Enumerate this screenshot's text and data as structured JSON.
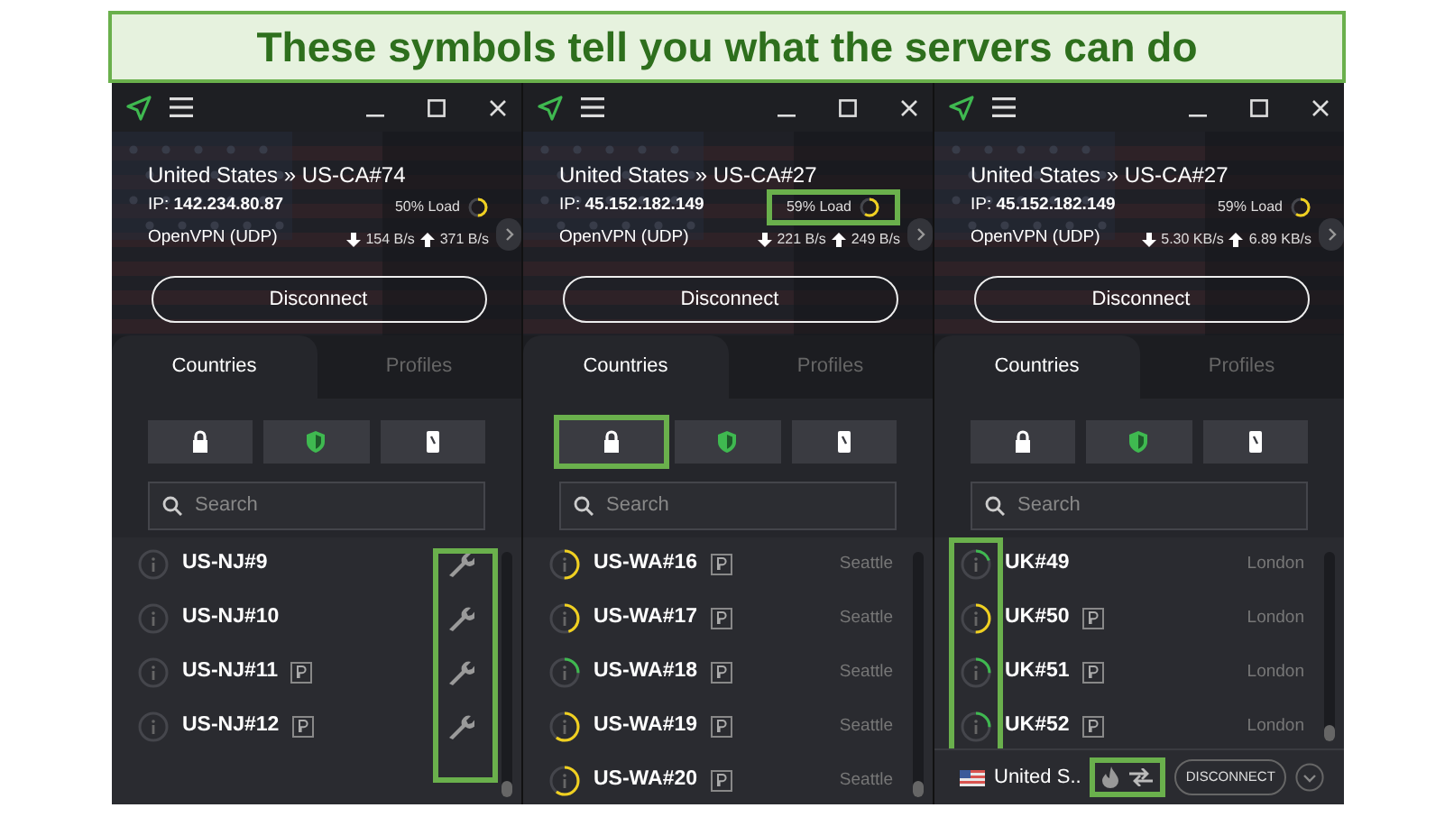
{
  "banner": {
    "text": "These symbols tell you what the servers can do"
  },
  "panels": [
    {
      "connection": {
        "location": "United States » US-CA#74",
        "ip_label": "IP:",
        "ip": "142.234.80.87",
        "load": "50% Load",
        "level": 0.5,
        "load_highlighted": false,
        "protocol": "OpenVPN (UDP)",
        "down": "154 B/s",
        "up": "371 B/s"
      },
      "disconnect": "Disconnect",
      "tabs": [
        {
          "label": "Countries",
          "selected": true
        },
        {
          "label": "Profiles",
          "selected": false
        }
      ],
      "filters": [
        {
          "kind": "lock",
          "highlighted": false
        },
        {
          "kind": "shield",
          "highlighted": false
        },
        {
          "kind": "device",
          "highlighted": false
        }
      ],
      "search": {
        "placeholder": "Search"
      },
      "actions_highlighted": true,
      "servers": [
        {
          "kind": "maintenance",
          "name": "US-NJ#9",
          "plus": false
        },
        {
          "kind": "maintenance",
          "name": "US-NJ#10",
          "plus": false
        },
        {
          "kind": "maintenance",
          "name": "US-NJ#11",
          "plus": true
        },
        {
          "kind": "maintenance",
          "name": "US-NJ#12",
          "plus": true
        }
      ]
    },
    {
      "connection": {
        "location": "United States » US-CA#27",
        "ip_label": "IP:",
        "ip": "45.152.182.149",
        "load": "59% Load",
        "level": 0.59,
        "load_highlighted": true,
        "protocol": "OpenVPN (UDP)",
        "down": "221 B/s",
        "up": "249 B/s"
      },
      "disconnect": "Disconnect",
      "tabs": [
        {
          "label": "Countries",
          "selected": true
        },
        {
          "label": "Profiles",
          "selected": false
        }
      ],
      "filters": [
        {
          "kind": "lock",
          "highlighted": true
        },
        {
          "kind": "shield",
          "highlighted": false
        },
        {
          "kind": "device",
          "highlighted": false
        }
      ],
      "search": {
        "placeholder": "Search"
      },
      "servers": [
        {
          "kind": "online",
          "name": "US-WA#16",
          "plus": true,
          "city": "Seattle",
          "level": 0.5
        },
        {
          "kind": "online",
          "name": "US-WA#17",
          "plus": true,
          "city": "Seattle",
          "level": 0.45
        },
        {
          "kind": "online",
          "name": "US-WA#18",
          "plus": true,
          "city": "Seattle",
          "level": 0.25
        },
        {
          "kind": "online",
          "name": "US-WA#19",
          "plus": true,
          "city": "Seattle",
          "level": 0.6
        },
        {
          "kind": "online",
          "name": "US-WA#20",
          "plus": true,
          "city": "Seattle",
          "level": 0.6
        }
      ]
    },
    {
      "connection": {
        "location": "United States » US-CA#27",
        "ip_label": "IP:",
        "ip": "45.152.182.149",
        "load": "59% Load",
        "level": 0.59,
        "load_highlighted": false,
        "protocol": "OpenVPN (UDP)",
        "down": "5.30 KB/s",
        "up": "6.89 KB/s"
      },
      "disconnect": "Disconnect",
      "tabs": [
        {
          "label": "Countries",
          "selected": true
        },
        {
          "label": "Profiles",
          "selected": false
        }
      ],
      "filters": [
        {
          "kind": "lock",
          "highlighted": false
        },
        {
          "kind": "shield",
          "highlighted": false
        },
        {
          "kind": "device",
          "highlighted": false
        }
      ],
      "search": {
        "placeholder": "Search"
      },
      "status_highlighted": true,
      "servers": [
        {
          "kind": "online",
          "name": "UK#49",
          "plus": false,
          "city": "London",
          "level": 0.2
        },
        {
          "kind": "online",
          "name": "UK#50",
          "plus": true,
          "city": "London",
          "level": 0.5
        },
        {
          "kind": "online",
          "name": "UK#51",
          "plus": true,
          "city": "London",
          "level": 0.25
        },
        {
          "kind": "online",
          "name": "UK#52",
          "plus": true,
          "city": "London",
          "level": 0.25
        }
      ],
      "footer": {
        "country": "United S..",
        "actions_highlighted": true,
        "disconnect": "DISCONNECT"
      }
    }
  ]
}
